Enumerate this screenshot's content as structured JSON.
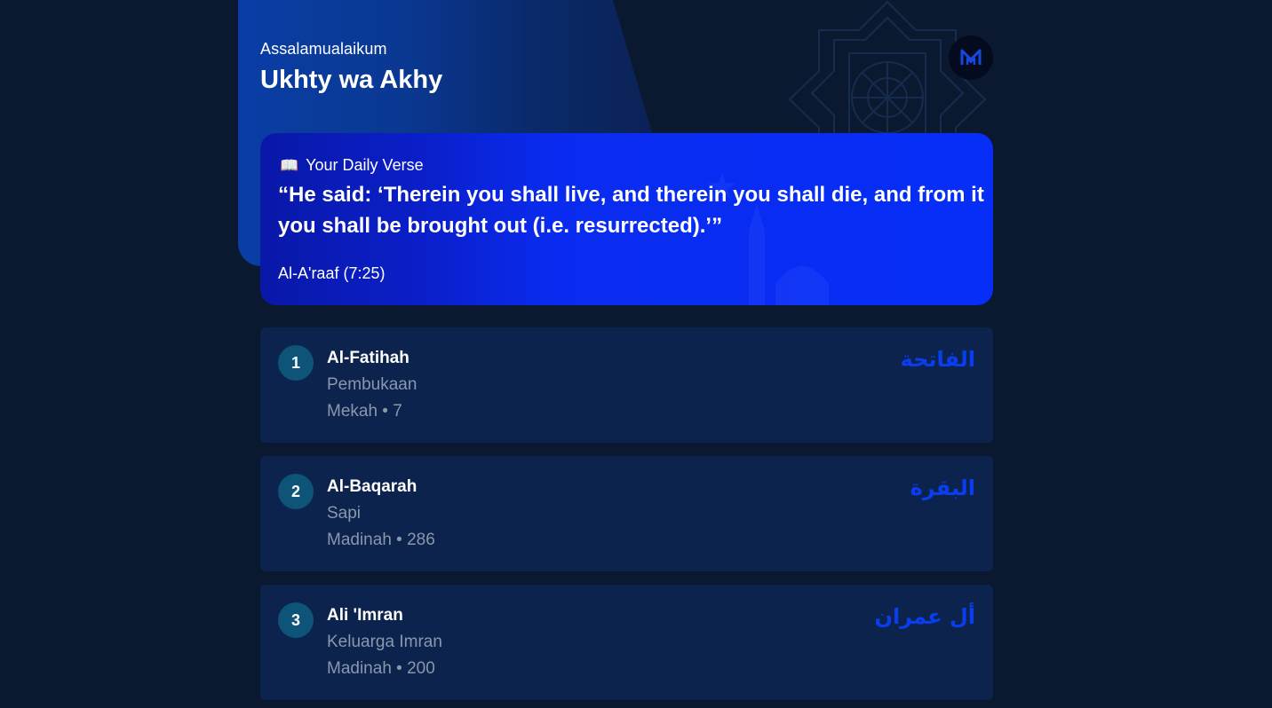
{
  "header": {
    "greeting": "Assalamualaikum",
    "username": "Ukhty wa Akhy",
    "logo_icon": "m-logo-icon",
    "ornament_icon": "islamic-star-ornament-icon"
  },
  "daily_verse": {
    "icon": "open-book-icon",
    "icon_glyph": "📖",
    "label": "Your Daily Verse",
    "text": "“He said: ‘Therein you shall live, and therein you shall die, and from it you shall be brought out (i.e. resurrected).’”",
    "reference": "Al-A'raaf (7:25)",
    "decor_icon": "crescent-mosque-icon"
  },
  "surahs": [
    {
      "number": "1",
      "name": "Al-Fatihah",
      "meaning": "Pembukaan",
      "meta": "Mekah • 7",
      "arabic": "الفاتحة"
    },
    {
      "number": "2",
      "name": "Al-Baqarah",
      "meaning": "Sapi",
      "meta": "Madinah • 286",
      "arabic": "البقرة"
    },
    {
      "number": "3",
      "name": "Ali 'Imran",
      "meaning": "Keluarga Imran",
      "meta": "Madinah • 200",
      "arabic": "أل عمران"
    }
  ],
  "colors": {
    "page_background": "#0b1930",
    "card_background": "#0c234d",
    "accent_blue": "#0a3df0",
    "badge": "#0d5478",
    "muted_text": "#8a97ad"
  }
}
